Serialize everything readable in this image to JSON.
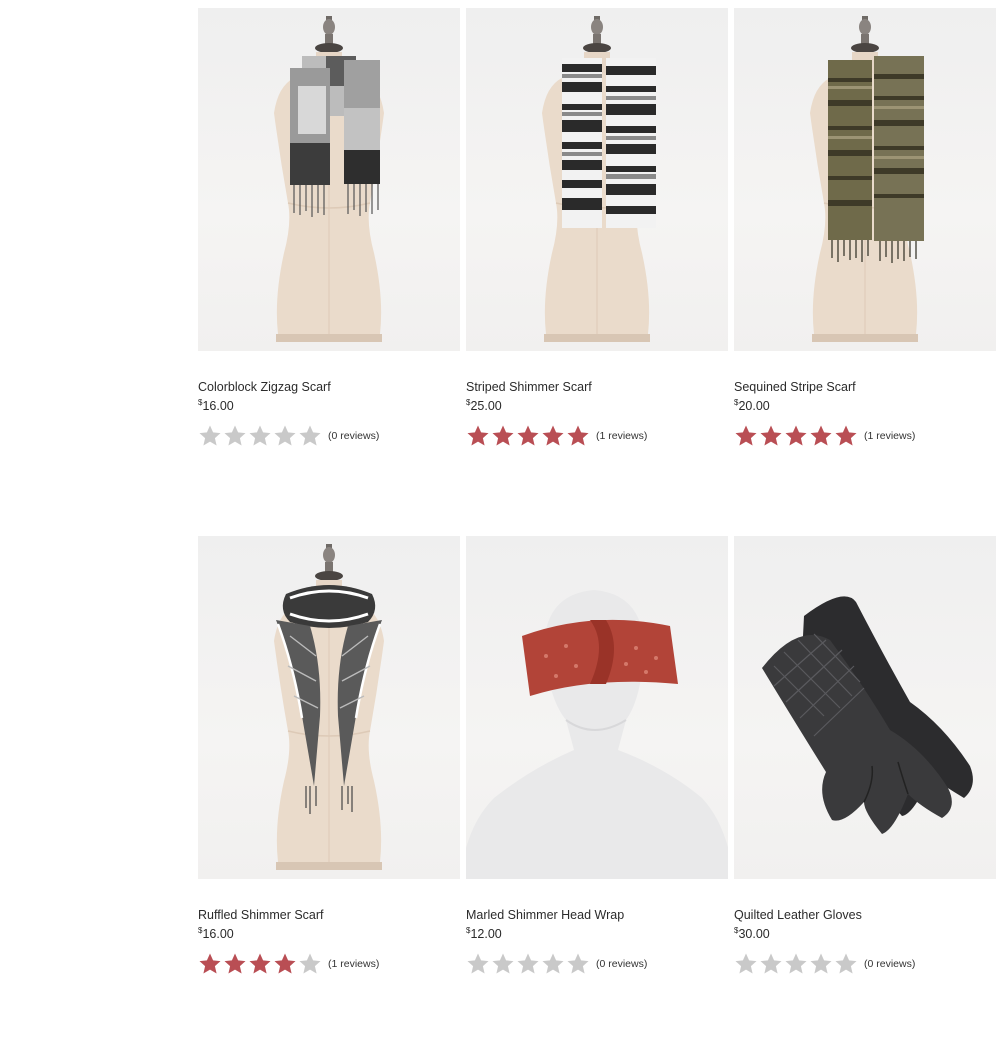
{
  "colors": {
    "star_on": "#b94e54",
    "star_off": "#c9c9c9"
  },
  "products": [
    {
      "name": "Colorblock Zigzag Scarf",
      "currency": "$",
      "price": "16.00",
      "rating": 0,
      "reviews": "(0 reviews)",
      "image": "gray-colorblock-scarf-on-mannequin"
    },
    {
      "name": "Striped Shimmer Scarf",
      "currency": "$",
      "price": "25.00",
      "rating": 5,
      "reviews": "(1 reviews)",
      "image": "black-white-striped-scarf-on-mannequin"
    },
    {
      "name": "Sequined Stripe Scarf",
      "currency": "$",
      "price": "20.00",
      "rating": 5,
      "reviews": "(1 reviews)",
      "image": "olive-sequined-scarf-on-mannequin"
    },
    {
      "name": "Ruffled Shimmer Scarf",
      "currency": "$",
      "price": "16.00",
      "rating": 4,
      "reviews": "(1 reviews)",
      "image": "black-white-ruffled-scarf-on-mannequin"
    },
    {
      "name": "Marled Shimmer Head Wrap",
      "currency": "$",
      "price": "12.00",
      "rating": 0,
      "reviews": "(0 reviews)",
      "image": "red-head-wrap-on-mannequin-head"
    },
    {
      "name": "Quilted Leather Gloves",
      "currency": "$",
      "price": "30.00",
      "rating": 0,
      "reviews": "(0 reviews)",
      "image": "black-quilted-leather-gloves"
    }
  ]
}
